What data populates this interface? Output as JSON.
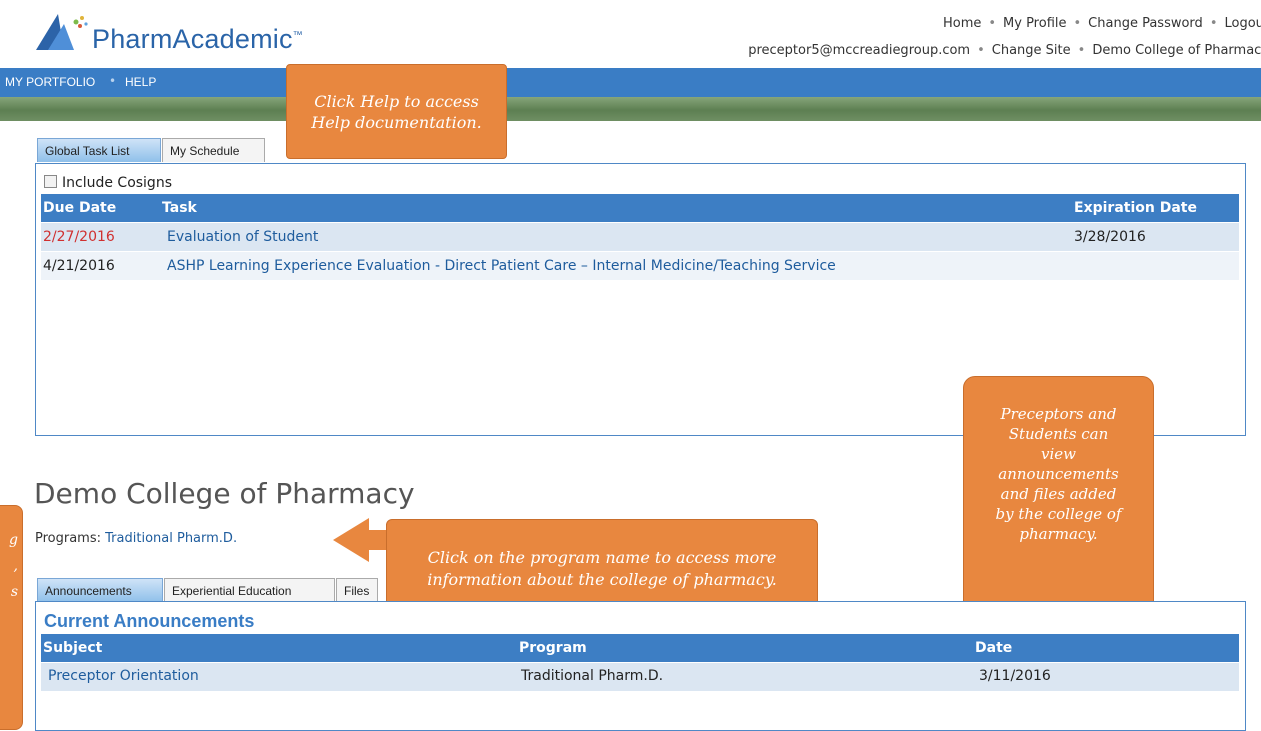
{
  "header": {
    "logo_text": "PharmAcademic",
    "logo_tm": "™",
    "top_links": [
      "Home",
      "My Profile",
      "Change Password",
      "Logout"
    ],
    "user_email": "preceptor5@mccreadiegroup.com",
    "change_site": "Change Site",
    "site_name": "Demo College of Pharmacy"
  },
  "nav": {
    "items": [
      "MY PORTFOLIO",
      "HELP"
    ]
  },
  "tasks": {
    "tabs": [
      "Global Task List",
      "My Schedule"
    ],
    "include_cosigns": "Include Cosigns",
    "columns": [
      "Due Date",
      "Task",
      "Expiration Date"
    ],
    "rows": [
      {
        "due": "2/27/2016",
        "task": "Evaluation of Student",
        "expires": "3/28/2016"
      },
      {
        "due": "4/21/2016",
        "task": "ASHP Learning Experience Evaluation - Direct Patient Care – Internal Medicine/Teaching Service",
        "expires": ""
      }
    ]
  },
  "college": {
    "name": "Demo College of Pharmacy",
    "programs_label": "Programs:",
    "program_link": "Traditional Pharm.D."
  },
  "announcements": {
    "tabs": [
      "Announcements",
      "Experiential Education",
      "Files"
    ],
    "heading": "Current Announcements",
    "columns": [
      "Subject",
      "Program",
      "Date"
    ],
    "rows": [
      {
        "subject": "Preceptor Orientation",
        "program": "Traditional Pharm.D.",
        "date": "3/11/2016"
      }
    ]
  },
  "callouts": {
    "help": [
      "Click Help to access",
      "Help documentation."
    ],
    "program": [
      "Click on the program name to access more",
      "information about the college of pharmacy."
    ],
    "preceptors": [
      "Preceptors and",
      "Students can",
      "view",
      "announcements",
      "and files added",
      "by the college of",
      "pharmacy."
    ],
    "left_partial": [
      "g",
      ",",
      "s"
    ]
  },
  "colors": {
    "nav_blue": "#3a7dc5",
    "callout_orange": "#e8873f",
    "overdue_red": "#d03030"
  }
}
